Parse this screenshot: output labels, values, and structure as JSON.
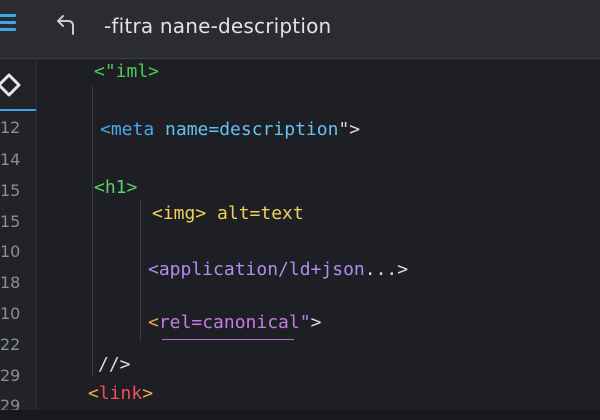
{
  "header": {
    "title": "-fitra nane-description",
    "icons": [
      "menu-icon",
      "back-arrow-icon"
    ]
  },
  "sidebar": {
    "active_icon": "diamond-code-icon"
  },
  "line_numbers": [
    "12",
    "14",
    "15",
    "15",
    "10",
    "18",
    "10",
    "22",
    "29",
    "29"
  ],
  "code_lines": [
    {
      "parts": [
        "<\"iml>"
      ]
    },
    {
      "parts": [
        "<meta ",
        "name=",
        "description",
        "\">"
      ]
    },
    {
      "parts": [
        "<h1>"
      ]
    },
    {
      "parts": [
        "<img>",
        " alt=text"
      ]
    },
    {
      "parts": [
        "<application/ld+json",
        "...>"
      ]
    },
    {
      "parts": [
        "<",
        "rel=canonical",
        "\"",
        ">"
      ]
    },
    {
      "parts": [
        "//>"
      ]
    },
    {
      "parts": [
        "<",
        "link",
        ">"
      ]
    }
  ],
  "colors": {
    "accent": "#3ea6e8",
    "background": "#1d1f24",
    "header": "#2a2c31",
    "tag_green": "#4ec95c",
    "attr_blue": "#4aa9ec",
    "img_yellow": "#f2d15a",
    "app_purple": "#b28cf0",
    "link_red": "#ee4f5a",
    "bracket_orange": "#f0a94a"
  }
}
